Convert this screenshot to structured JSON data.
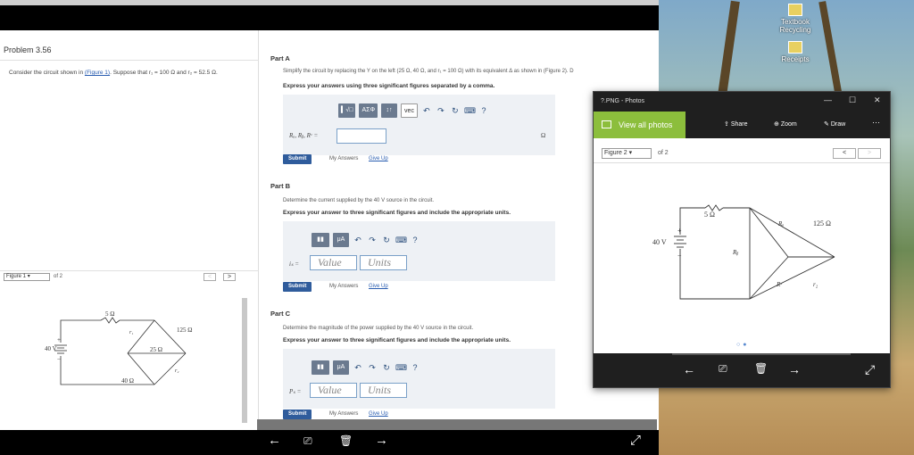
{
  "desktop": {
    "icons": [
      {
        "label": "Textbook Recycling",
        "icon": "folder-icon"
      },
      {
        "label": "Receipts",
        "icon": "folder-icon"
      }
    ]
  },
  "problem": {
    "title": "Problem 3.56",
    "text_before": "Consider the circuit shown in ",
    "figure_link": "(Figure 1)",
    "text_after": ". Suppose that r₁ = 100  Ω and r₂ = 52.5  Ω.",
    "figure_select": "Figure 1",
    "figure_of": "of 2",
    "prev": "<",
    "next": ">"
  },
  "figure1": {
    "labels": {
      "r5": "5 Ω",
      "r125": "125 Ω",
      "r25": "25 Ω",
      "r40": "40 Ω",
      "src": "40 V",
      "r1": "r₁",
      "r2": "r₂",
      "plus": "+",
      "minus": "−"
    }
  },
  "partA": {
    "title": "Part A",
    "text": "Simplify the circuit by replacing the Y on the left (25 Ω, 40 Ω, and r₁ = 100  Ω) with its equivalent Δ as shown in (Figure 2).  D",
    "instruction": "Express your answers using three significant figures separated by a comma.",
    "label": "Rₐ, Rᵦ, Rᶜ =",
    "unit": "Ω",
    "tools": [
      "▍√□",
      "ΑΣΦ",
      "↕↑",
      "vec"
    ],
    "submit": "Submit",
    "my_answers": "My Answers",
    "give_up": "Give Up"
  },
  "partB": {
    "title": "Part B",
    "text": "Determine the current supplied by the 40 V source in the circuit.",
    "instruction": "Express your answer to three significant figures and include the appropriate units.",
    "label": "iₛ =",
    "value_placeholder": "Value",
    "units_placeholder": "Units",
    "tool_mu": "μA",
    "submit": "Submit",
    "my_answers": "My Answers",
    "give_up": "Give Up"
  },
  "partC": {
    "title": "Part C",
    "text": "Determine the magnitude of the power supplied by the 40 V source in the circuit.",
    "instruction": "Express your answer to three significant figures and include the appropriate units.",
    "label": "Pₛ =",
    "value_placeholder": "Value",
    "units_placeholder": "Units",
    "tool_mu": "μA",
    "submit": "Submit",
    "my_answers": "My Answers",
    "give_up": "Give Up"
  },
  "photos": {
    "window_title": "?.PNG - Photos",
    "view_all": "View all photos",
    "share": "Share",
    "zoom": "Zoom",
    "draw": "Draw",
    "more": "···",
    "figure_select": "Figure 2",
    "figure_of": "of 2",
    "prev": "<",
    "next": ">",
    "dots": "○●",
    "figure2": {
      "r5": "5 Ω",
      "r125": "125 Ω",
      "src": "40 V",
      "ra": "Rₐ",
      "rb": "Rᵦ",
      "rc": "Rᶜ",
      "r2": "r₂",
      "plus": "+",
      "minus": "−"
    }
  },
  "bottom_bar": {
    "icons": [
      "back-arrow-icon",
      "save-icon",
      "delete-icon",
      "forward-arrow-icon",
      "expand-icon"
    ]
  }
}
